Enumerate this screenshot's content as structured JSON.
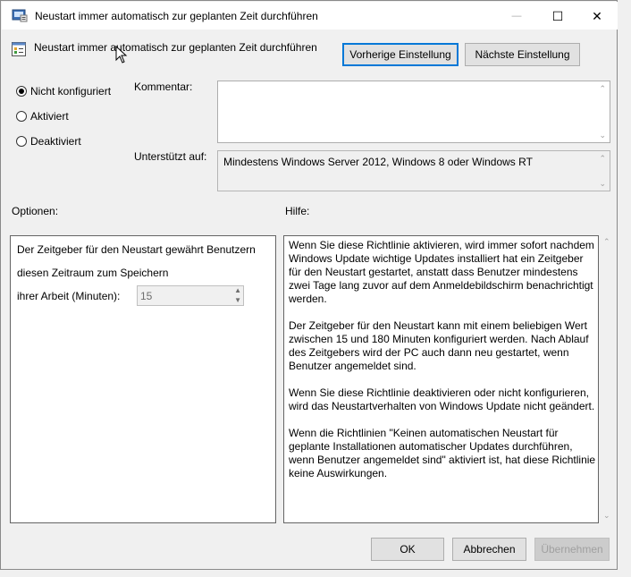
{
  "window": {
    "title": "Neustart immer automatisch zur geplanten Zeit durchführen",
    "controls": {
      "minimize": "—",
      "maximize": "☐",
      "close": "✕"
    }
  },
  "header": {
    "policy_name": "Neustart immer automatisch zur geplanten Zeit durchführen",
    "prev_button": "Vorherige Einstellung",
    "next_button": "Nächste Einstellung"
  },
  "state": {
    "options": [
      {
        "label": "Nicht konfiguriert",
        "selected": true
      },
      {
        "label": "Aktiviert",
        "selected": false
      },
      {
        "label": "Deaktiviert",
        "selected": false
      }
    ]
  },
  "comment": {
    "label": "Kommentar:",
    "value": ""
  },
  "supported": {
    "label": "Unterstützt auf:",
    "value": "Mindestens Windows Server 2012, Windows 8 oder Windows RT"
  },
  "options_panel": {
    "heading": "Optionen:",
    "line1": "Der Zeitgeber für den  Neustart gewährt Benutzern",
    "line2": "diesen Zeitraum zum Speichern",
    "field_label": "ihrer Arbeit (Minuten):",
    "field_value": "15"
  },
  "help_panel": {
    "heading": "Hilfe:",
    "paragraphs": [
      "Wenn Sie diese Richtlinie aktivieren, wird immer sofort nachdem Windows Update wichtige Updates installiert hat ein Zeitgeber für den Neustart gestartet, anstatt dass Benutzer mindestens zwei Tage lang zuvor auf dem Anmeldebildschirm benachrichtigt werden.",
      "Der Zeitgeber für den Neustart kann mit einem beliebigen Wert zwischen 15 und 180 Minuten konfiguriert werden. Nach Ablauf des Zeitgebers wird der PC auch dann neu gestartet, wenn Benutzer angemeldet sind.",
      "Wenn Sie diese Richtlinie deaktivieren oder nicht konfigurieren, wird das Neustartverhalten von Windows Update nicht geändert.",
      "Wenn die Richtlinien \"Keinen automatischen Neustart für geplante Installationen automatischer Updates durchführen, wenn Benutzer angemeldet sind\" aktiviert ist, hat diese Richtlinie keine Auswirkungen."
    ]
  },
  "footer": {
    "ok": "OK",
    "cancel": "Abbrechen",
    "apply": "Übernehmen"
  }
}
